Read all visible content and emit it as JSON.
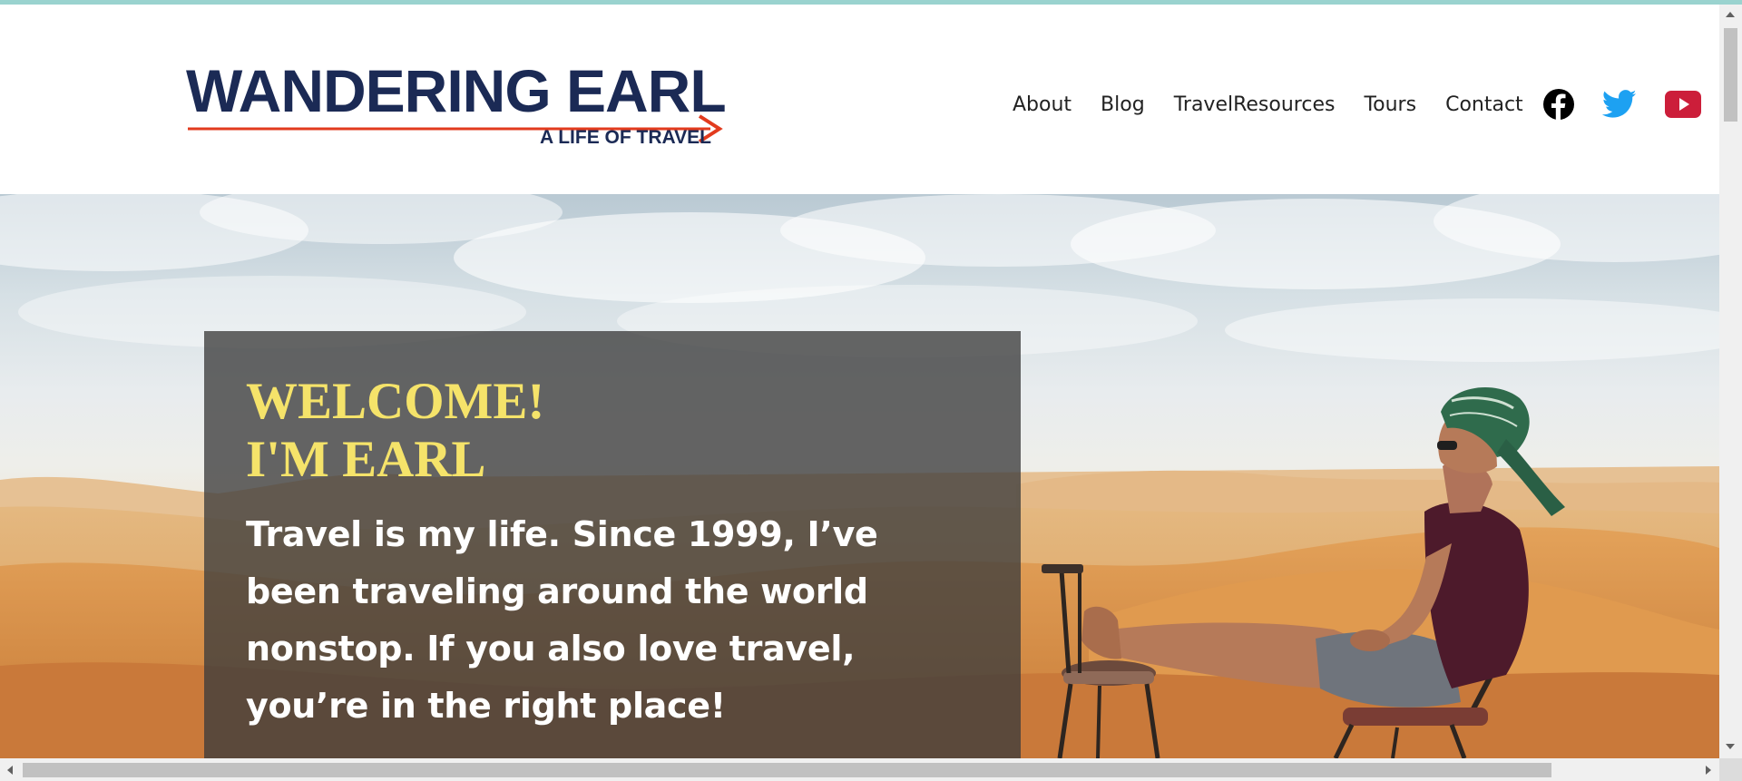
{
  "site": {
    "logo_title": "WANDERING EARL",
    "logo_tagline": "A LIFE OF TRAVEL"
  },
  "nav": {
    "items": [
      {
        "label": "About"
      },
      {
        "label": "Blog"
      },
      {
        "label": "TravelResources"
      },
      {
        "label": "Tours"
      },
      {
        "label": "Contact"
      }
    ],
    "social": [
      {
        "icon": "facebook-icon",
        "color": "#000000"
      },
      {
        "icon": "twitter-icon",
        "color": "#1da1f2"
      },
      {
        "icon": "youtube-icon",
        "color": "#cc1e3a"
      }
    ]
  },
  "hero": {
    "welcome_line1": "WELCOME!",
    "welcome_line2": "I'M EARL",
    "intro": "Travel is my life. Since 1999, I’ve been traveling around the world nonstop. If you also love travel, you’re in the right place!",
    "image_subject": "man-in-turban-sitting-in-desert"
  },
  "colors": {
    "brand_navy": "#1b2a55",
    "arrow_red": "#e23b1e",
    "welcome_yellow": "#f5e36a",
    "top_accent": "#9ad3cf"
  }
}
